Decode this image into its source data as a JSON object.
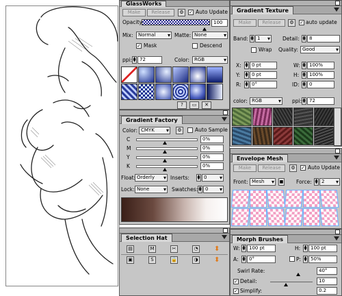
{
  "glassworks": {
    "title": "GlassWorks",
    "make": "Make",
    "release": "Release",
    "auto_update": "Auto Update",
    "opacity_label": "Opacity:",
    "opacity_value": "100",
    "opacity_level": 0.92,
    "mix_label": "Mix:",
    "mix_value": "Normal",
    "matte_label": "Matte:",
    "matte_value": "None",
    "mask_label": "Mask",
    "descend_label": "Descend",
    "ppi_label": "ppi:",
    "ppi_value": "72",
    "color_label": "Color:",
    "color_value": "RGB",
    "footer_q": "?"
  },
  "gradient_factory": {
    "title": "Gradient Factory",
    "color_label": "Color:",
    "color_value": "CMYK",
    "auto_sample": "Auto Sample",
    "channels": [
      {
        "label": "C",
        "value": "0%",
        "level": 0.45
      },
      {
        "label": "M",
        "value": "0%",
        "level": 0.45
      },
      {
        "label": "Y",
        "value": "0%",
        "level": 0.45
      },
      {
        "label": "K",
        "value": "0%",
        "level": 0.45
      }
    ],
    "float_label": "Float:",
    "float_value": "Orderly",
    "inserts_label": "Inserts:",
    "inserts_value": "0",
    "lock_label": "Lock:",
    "lock_value": "None",
    "swatches_label": "Swatches:",
    "swatches_value": "0"
  },
  "selection_hat": {
    "title": "Selection Hat",
    "row2_label": "S"
  },
  "gradient_texture": {
    "title": "Gradient Texture",
    "make": "Make",
    "release": "Release",
    "auto_update": "auto update",
    "band_label": "Band:",
    "band_value": "1",
    "detail_label": "Detail:",
    "detail_value": "8",
    "wrap_label": "Wrap",
    "quality_label": "Quality:",
    "quality_value": "Good",
    "x_label": "X:",
    "x_value": "0 pt",
    "w_label": "W:",
    "w_value": "100%",
    "y_label": "Y:",
    "y_value": "0 pt",
    "h_label": "H:",
    "h_value": "100%",
    "r_label": "R:",
    "r_value": "0°",
    "id_label": "ID:",
    "id_value": "0",
    "color_label": "color:",
    "color_value": "RGB",
    "ppi_label": "ppi:",
    "ppi_value": "72"
  },
  "envelope_mesh": {
    "title": "Envelope Mesh",
    "make": "Make",
    "release": "Release",
    "auto_update": "Auto Update",
    "front_label": "Front:",
    "front_value": "Mesh",
    "force_label": "Force:",
    "force_value": "2"
  },
  "morph_brushes": {
    "title": "Morph Brushes",
    "w_label": "W:",
    "w_value": "100 pt",
    "h_label": "H:",
    "h_value": "100 pt",
    "a_label": "A:",
    "a_value": "0°",
    "p_label": "P:",
    "p_value": "50%",
    "swirl_label": "Swirl Rate:",
    "swirl_value": "40°",
    "detail_label": "Detail:",
    "detail_value": "10",
    "simplify_label": "Simplify:",
    "simplify_value": "0.2"
  },
  "colors": {
    "panel_bg": "#c6c6c6",
    "accent_orange": "#e07a1a",
    "mesh_pink": "#f3a0c4",
    "mesh_blue": "#6fb3ff"
  }
}
